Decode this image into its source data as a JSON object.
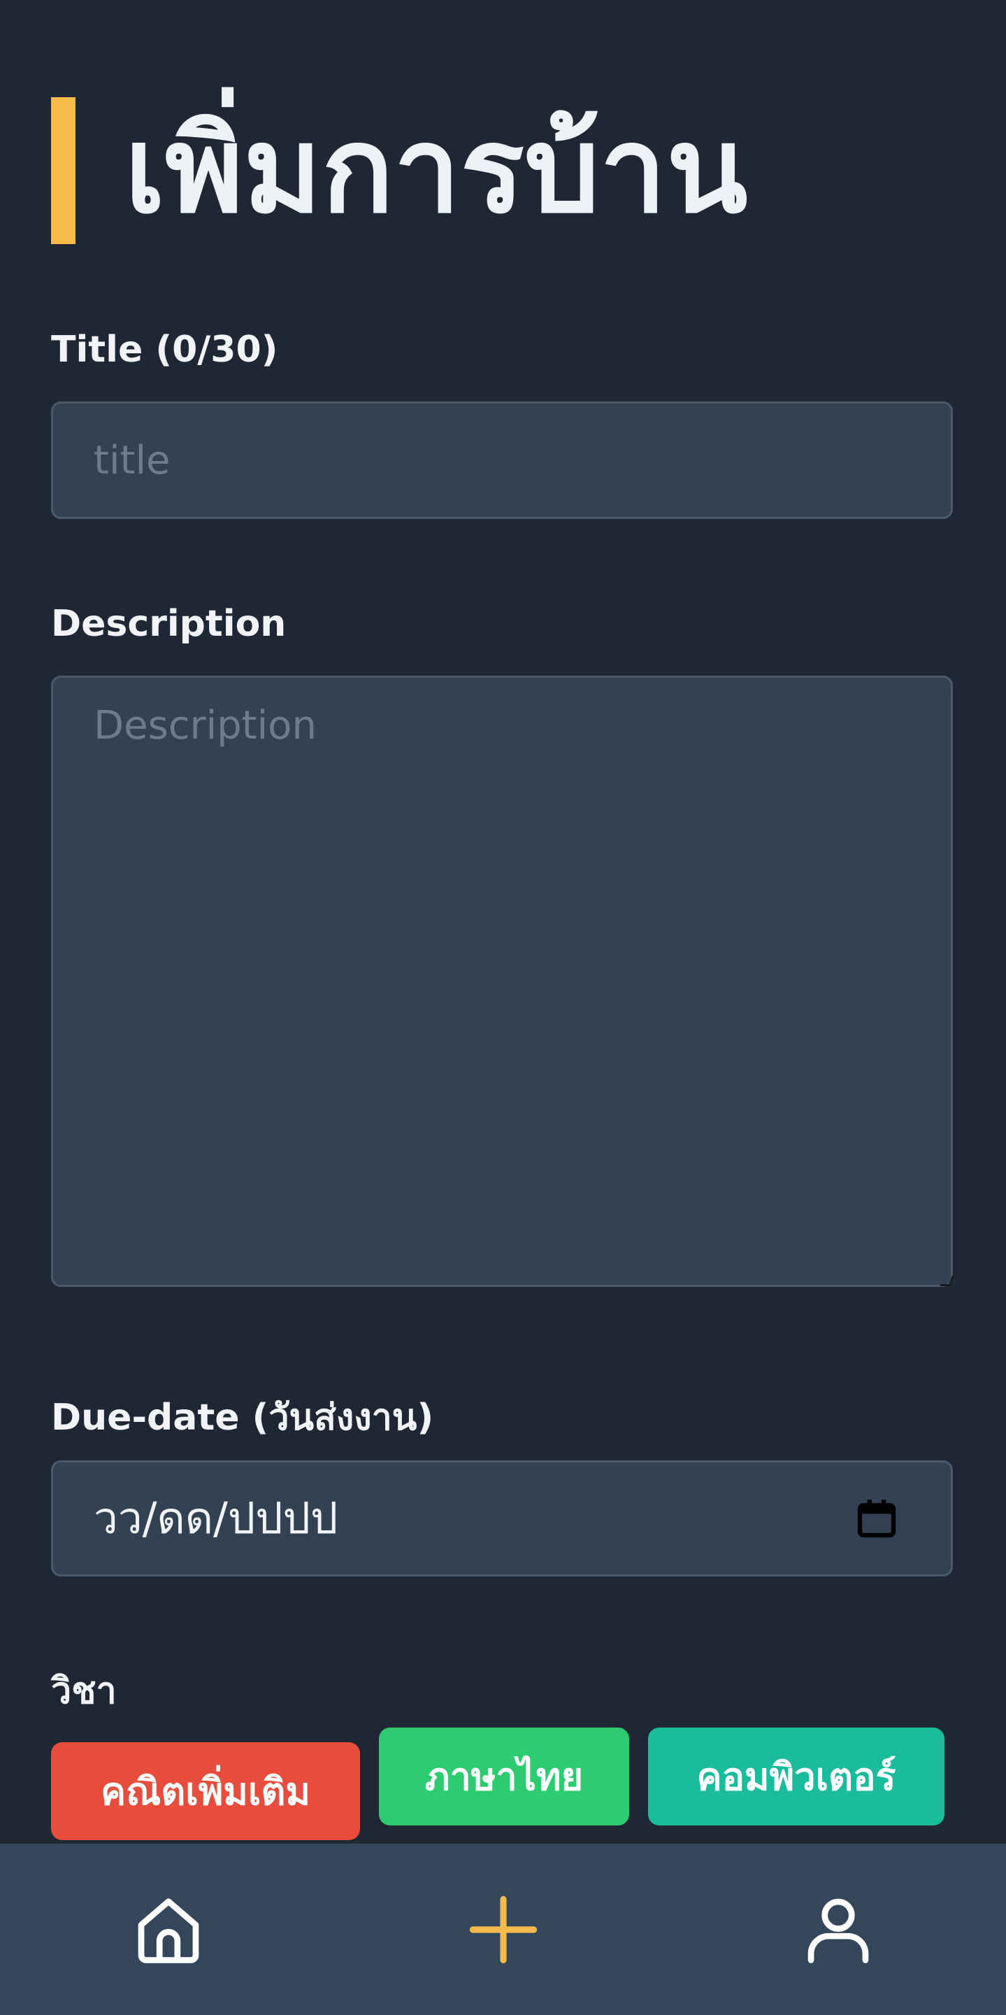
{
  "page": {
    "heading": "เพิ่มการบ้าน"
  },
  "form": {
    "title_label": "Title (0/30)",
    "title_placeholder": "title",
    "title_value": "",
    "description_label": "Description",
    "description_placeholder": "Description",
    "description_value": "",
    "due_date_label": "Due-date (วันส่งงาน)",
    "due_date_value": "วว/ดด/ปปปป",
    "subject_label": "วิชา"
  },
  "subjects": [
    {
      "label": "คณิตเพิ่มเติม",
      "color": "#e74c3c"
    },
    {
      "label": "ภาษาไทย",
      "color": "#2ecc71"
    },
    {
      "label": "คอมพิวเตอร์",
      "color": "#1abc9c"
    }
  ],
  "nav": {
    "items": [
      {
        "icon": "home-icon"
      },
      {
        "icon": "plus-icon",
        "color": "#f6bb4b"
      },
      {
        "icon": "user-icon"
      }
    ]
  },
  "colors": {
    "background": "#1e2733",
    "input_background": "#334252",
    "accent": "#f6bb4b",
    "nav_background": "#34465b"
  }
}
